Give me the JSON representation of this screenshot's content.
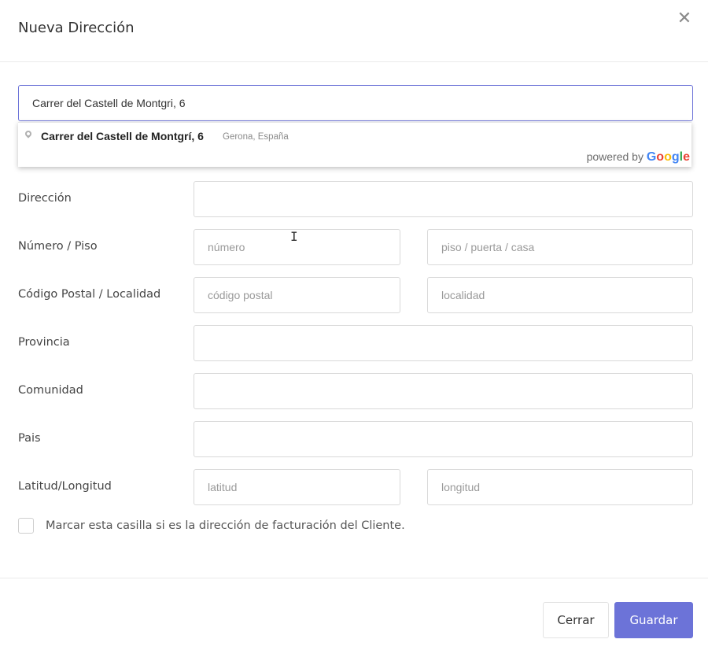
{
  "modal": {
    "title": "Nueva Dirección",
    "close_icon": "close-icon",
    "close_glyph": "✕"
  },
  "search": {
    "value": "Carrer del Castell de Montgri, 6"
  },
  "autocomplete": {
    "main_text": "Carrer del Castell de Montgrí, 6",
    "secondary_text": "Gerona, España",
    "powered_by": "powered by",
    "logo_letters": [
      "G",
      "o",
      "o",
      "g",
      "l",
      "e"
    ]
  },
  "form": {
    "direccion": {
      "label": "Dirección",
      "value": ""
    },
    "numero_piso": {
      "label": "Número / Piso",
      "numero_placeholder": "número",
      "piso_placeholder": "piso / puerta / casa"
    },
    "cp_localidad": {
      "label": "Código Postal / Localidad",
      "cp_placeholder": "código postal",
      "localidad_placeholder": "localidad"
    },
    "provincia": {
      "label": "Provincia",
      "value": ""
    },
    "comunidad": {
      "label": "Comunidad",
      "value": ""
    },
    "pais": {
      "label": "Pais",
      "value": ""
    },
    "lat_lng": {
      "label": "Latitud/Longitud",
      "lat_placeholder": "latitud",
      "lng_placeholder": "longitud"
    },
    "billing_checkbox": {
      "label": "Marcar esta casilla si es la dirección de facturación del Cliente.",
      "checked": false
    }
  },
  "footer": {
    "close_label": "Cerrar",
    "save_label": "Guardar"
  },
  "colors": {
    "accent": "#6c73d8",
    "border": "#d9d9d9"
  }
}
